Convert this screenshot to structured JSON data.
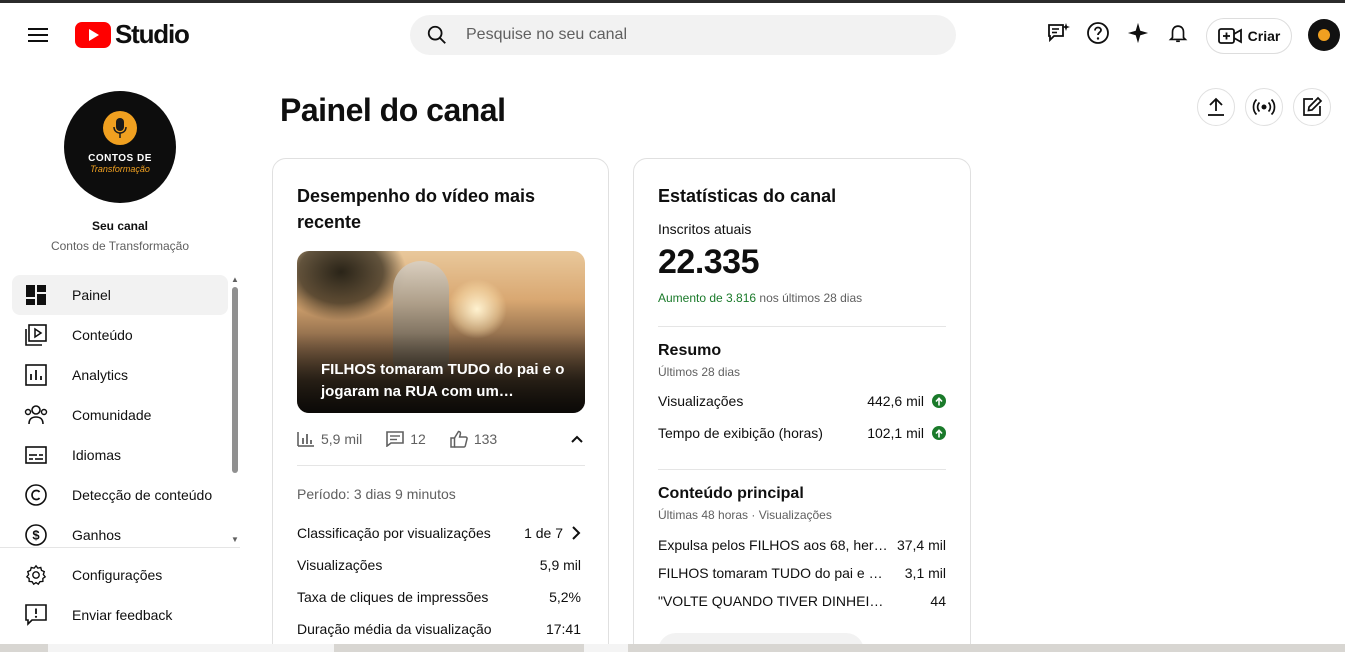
{
  "header": {
    "logo_text": "Studio",
    "search_placeholder": "Pesquise no seu canal",
    "create_label": "Criar"
  },
  "sidebar": {
    "channel_label": "Seu canal",
    "channel_name": "Contos de Transformação",
    "avatar_line1": "CONTOS DE",
    "avatar_line2": "Transformação",
    "items": [
      {
        "label": "Painel",
        "icon": "dashboard-icon",
        "active": true
      },
      {
        "label": "Conteúdo",
        "icon": "content-icon"
      },
      {
        "label": "Analytics",
        "icon": "analytics-icon"
      },
      {
        "label": "Comunidade",
        "icon": "community-icon"
      },
      {
        "label": "Idiomas",
        "icon": "subtitles-icon"
      },
      {
        "label": "Detecção de conteúdo",
        "icon": "copyright-icon"
      },
      {
        "label": "Ganhos",
        "icon": "earn-icon"
      }
    ],
    "bottom_items": [
      {
        "label": "Configurações",
        "icon": "settings-icon"
      },
      {
        "label": "Enviar feedback",
        "icon": "feedback-icon"
      }
    ]
  },
  "main": {
    "title": "Painel do canal"
  },
  "latest_video": {
    "card_title": "Desempenho do vídeo mais recente",
    "video_title": "FILHOS tomaram TUDO do pai e o jogaram na RUA com um…",
    "views": "5,9 mil",
    "comments": "12",
    "likes": "133",
    "period": "Período: 3 dias 9 minutos",
    "metrics": [
      {
        "label": "Classificação por visualizações",
        "value": "1 de 7"
      },
      {
        "label": "Visualizações",
        "value": "5,9 mil"
      },
      {
        "label": "Taxa de cliques de impressões",
        "value": "5,2%"
      },
      {
        "label": "Duração média da visualização",
        "value": "17:41"
      }
    ]
  },
  "channel_stats": {
    "card_title": "Estatísticas do canal",
    "subs_label": "Inscritos atuais",
    "subs_value": "22.335",
    "growth_highlight": "Aumento de 3.816",
    "growth_rest": " nos últimos 28 dias",
    "summary_title": "Resumo",
    "summary_sub": "Últimos 28 dias",
    "summary_rows": [
      {
        "label": "Visualizações",
        "value": "442,6 mil"
      },
      {
        "label": "Tempo de exibição (horas)",
        "value": "102,1 mil"
      }
    ],
    "top_title": "Conteúdo principal",
    "top_sub": "Últimas 48 horas · Visualizações",
    "top_rows": [
      {
        "label": "Expulsa pelos FILHOS aos 68, herd…",
        "value": "37,4 mil"
      },
      {
        "label": "FILHOS tomaram TUDO do pai e o j…",
        "value": "3,1 mil"
      },
      {
        "label": "\"VOLTE QUANDO TIVER DINHEIRO\" …",
        "value": "44"
      }
    ]
  },
  "colors": {
    "youtube_red": "#ff0000",
    "growth_green": "#1a7a2a"
  }
}
